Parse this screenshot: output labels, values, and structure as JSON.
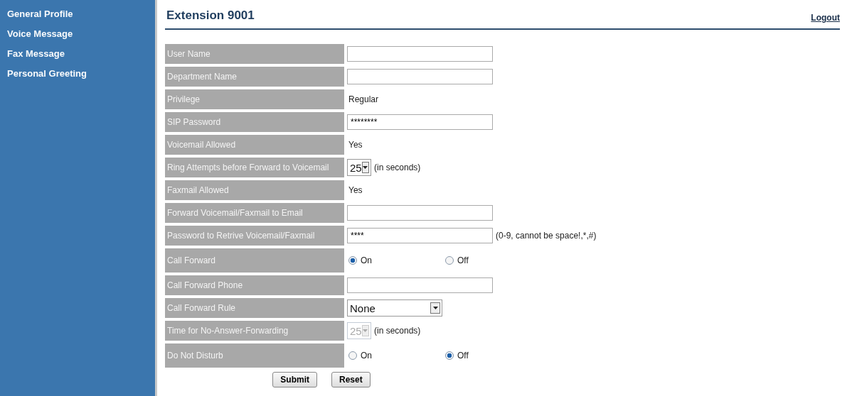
{
  "sidebar": {
    "items": [
      {
        "label": "General Profile"
      },
      {
        "label": "Voice Message"
      },
      {
        "label": "Fax Message"
      },
      {
        "label": "Personal Greeting"
      }
    ]
  },
  "header": {
    "title": "Extension 9001",
    "logout": "Logout"
  },
  "form": {
    "rows": [
      {
        "kind": "input",
        "label": "User Name"
      },
      {
        "kind": "input",
        "label": "Department Name"
      },
      {
        "kind": "text",
        "label": "Privilege",
        "value": "Regular"
      },
      {
        "kind": "input",
        "label": "SIP Password",
        "value": "********"
      },
      {
        "kind": "text",
        "label": "Voicemail Allowed",
        "value": "Yes"
      },
      {
        "kind": "select",
        "label": "Ring Attempts before Forward to Voicemail",
        "value": "25",
        "note": "(in seconds)",
        "disabled": false
      },
      {
        "kind": "text",
        "label": "Faxmail Allowed",
        "value": "Yes"
      },
      {
        "kind": "input",
        "label": "Forward Voicemail/Faxmail to Email"
      },
      {
        "kind": "input",
        "label": "Password to Retrive Voicemail/Faxmail",
        "value": "****",
        "note": "(0-9, cannot be space!,*,#)"
      },
      {
        "kind": "radio",
        "label": "Call Forward",
        "options": [
          {
            "label": "On",
            "selected": true
          },
          {
            "label": "Off",
            "selected": false
          }
        ]
      },
      {
        "kind": "input",
        "label": "Call Forward Phone"
      },
      {
        "kind": "wideselect",
        "label": "Call Forward Rule",
        "value": "None",
        "disabled": false
      },
      {
        "kind": "select",
        "label": "Time for No-Answer-Forwarding",
        "value": "25",
        "note": "(in seconds)",
        "disabled": true
      },
      {
        "kind": "radio",
        "label": "Do Not Disturb",
        "options": [
          {
            "label": "On",
            "selected": false
          },
          {
            "label": "Off",
            "selected": true
          }
        ]
      }
    ],
    "buttons": [
      "Submit",
      "Reset"
    ]
  }
}
